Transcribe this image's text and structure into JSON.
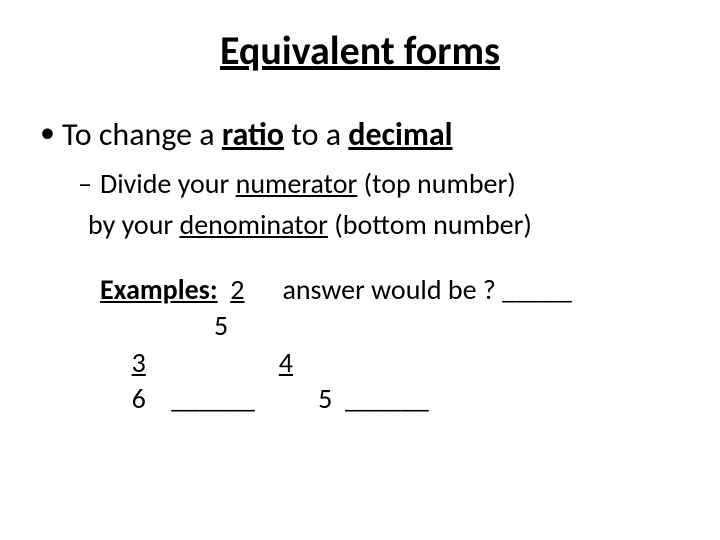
{
  "title": "Equivalent forms",
  "bullet1": {
    "pre": "To change a ",
    "u1": "ratio",
    "mid": " to a ",
    "u2": "decimal"
  },
  "bullet2": {
    "line1_pre": "Divide your ",
    "line1_u": "numerator",
    "line1_post": " (top number)",
    "line2_pre": "by your ",
    "line2_u": "denominator",
    "line2_post": " (bottom number)"
  },
  "examples": {
    "label": "Examples:",
    "frac1_num": "2",
    "frac1_den": "5",
    "ans1_text": "answer would be ? _____",
    "frac2_num": "3",
    "frac2_den": "6",
    "blank2": "______",
    "frac3_num": "4",
    "frac3_den": "5",
    "blank3": "______"
  }
}
